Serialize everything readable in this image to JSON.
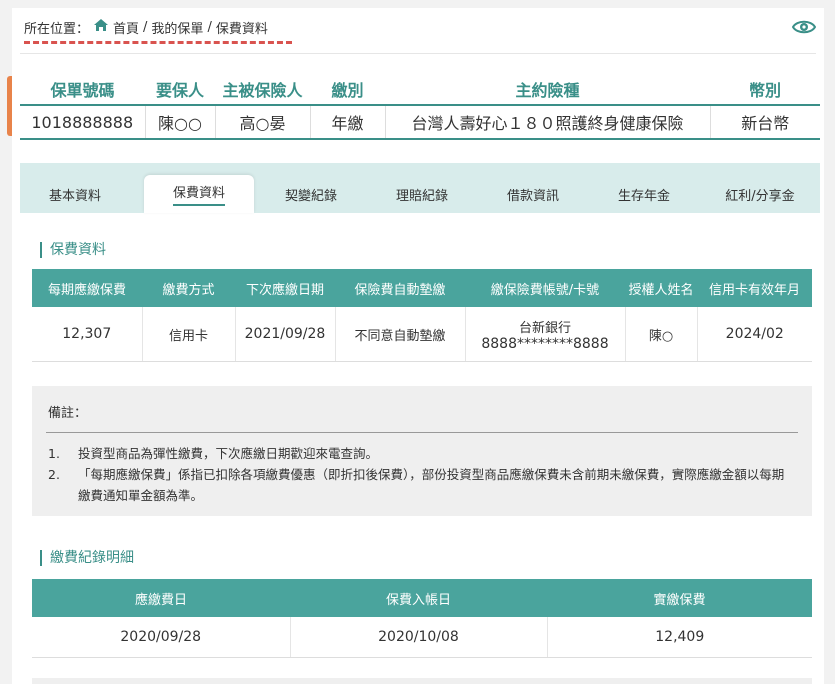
{
  "breadcrumb": {
    "prefix": "所在位置：",
    "home": "首頁",
    "sep1": "/",
    "my_policy": "我的保單",
    "sep2": "/",
    "current": "保費資料"
  },
  "policy": {
    "headers": [
      "保單號碼",
      "要保人",
      "主被保險人",
      "繳別",
      "主約險種",
      "幣別"
    ],
    "row": [
      "1018888888",
      "陳○○",
      "高○晏",
      "年繳",
      "台灣人壽好心１８０照護終身健康保險",
      "新台幣"
    ]
  },
  "tabs": [
    "基本資料",
    "保費資料",
    "契變紀錄",
    "理賠紀錄",
    "借款資訊",
    "生存年金",
    "紅利/分享金"
  ],
  "active_tab": "保費資料",
  "premium": {
    "section_title": "保費資料",
    "headers": [
      "每期應繳保費",
      "繳費方式",
      "下次應繳日期",
      "保險費自動墊繳",
      "繳保險費帳號/卡號",
      "授權人姓名",
      "信用卡有效年月"
    ],
    "row": {
      "amount": "12,307",
      "method": "信用卡",
      "next_date": "2021/09/28",
      "auto_loan": "不同意自動墊繳",
      "bank": "台新銀行",
      "account": "8888********8888",
      "authorizer": "陳○",
      "card_expiry": "2024/02"
    }
  },
  "notes": {
    "title": "備註：",
    "items": [
      {
        "num": "1.",
        "text": "投資型商品為彈性繳費，下次應繳日期歡迎來電查詢。"
      },
      {
        "num": "2.",
        "text": "「每期應繳保費」係指已扣除各項繳費優惠（即折扣後保費），部份投資型商品應繳保費未含前期未繳保費，實際應繳金額以每期繳費通知單金額為準。"
      }
    ]
  },
  "history": {
    "section_title": "繳費紀錄明細",
    "headers": [
      "應繳費日",
      "保費入帳日",
      "實繳保費"
    ],
    "rows": [
      [
        "2020/09/28",
        "2020/10/08",
        "12,409"
      ]
    ]
  },
  "colors": {
    "accent": "#4aa49d",
    "title": "#3a8f88",
    "dash": "#d9534f",
    "tab_bg": "#d8eceb"
  },
  "icons": {
    "home": "home-icon",
    "eye": "eye-icon"
  }
}
